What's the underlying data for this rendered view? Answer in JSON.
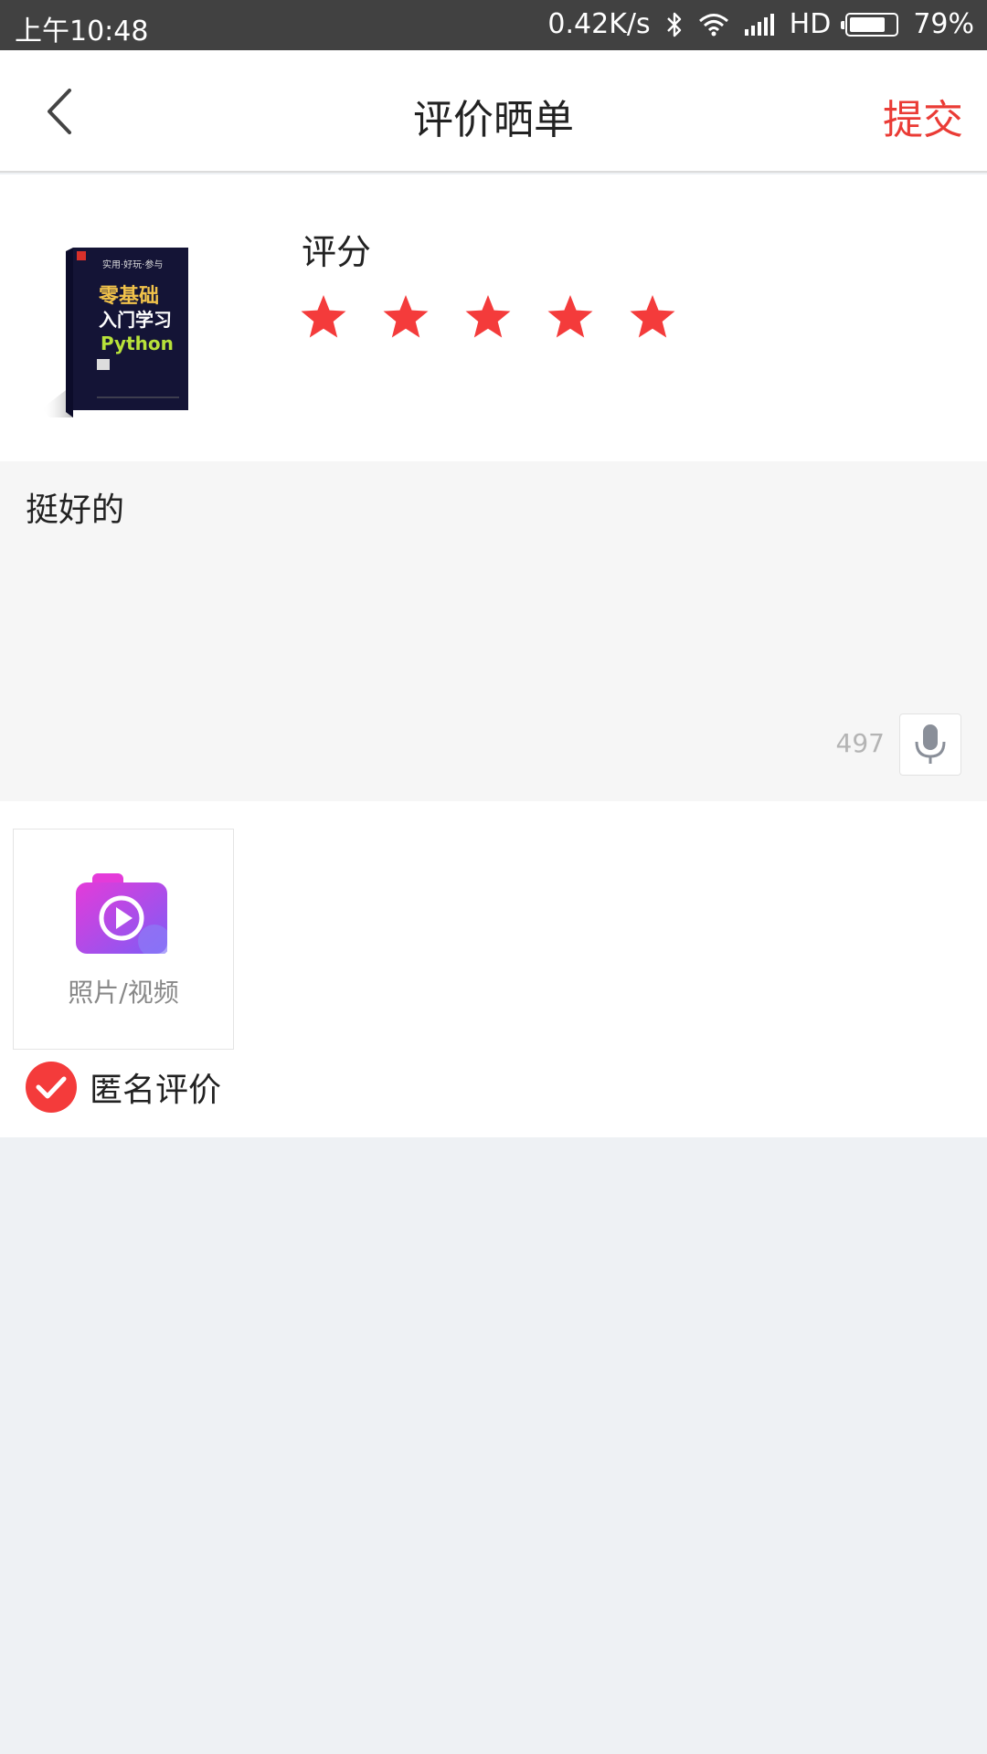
{
  "status_bar": {
    "time": "上午10:48",
    "net_speed": "0.42K/s",
    "network": "HD",
    "battery": "79%",
    "battery_level": 0.79
  },
  "nav": {
    "title": "评价晒单",
    "submit_label": "提交"
  },
  "product": {
    "rating_label": "评分",
    "rating": 5,
    "max_rating": 5,
    "accent_color": "#f43b3b"
  },
  "comment": {
    "text": "挺好的",
    "remaining_chars": "497"
  },
  "media": {
    "add_label": "照片/视频"
  },
  "anonymous": {
    "label": "匿名评价",
    "checked": true
  },
  "book_cover": {
    "top_line": "实用·好玩·参与",
    "title_line1": "零基础",
    "title_line2": "入门学习",
    "title_line3": "Python"
  }
}
